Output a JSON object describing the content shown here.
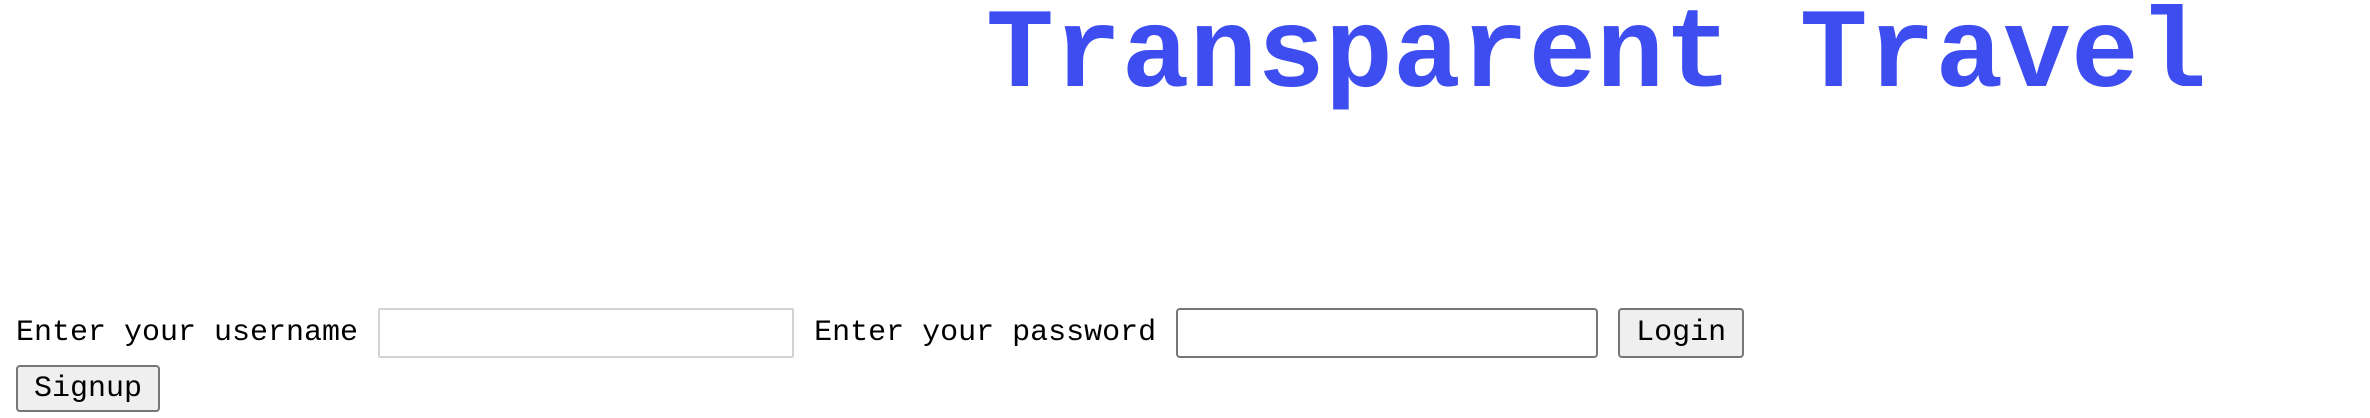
{
  "header": {
    "title": "Transparent Travel"
  },
  "login_form": {
    "username_label": "Enter your username",
    "username_value": "",
    "password_label": "Enter your password",
    "password_value": "",
    "login_button": "Login",
    "signup_button": "Signup"
  },
  "colors": {
    "title": "#3d4df0",
    "button_bg": "#efefef",
    "border": "#767676"
  }
}
